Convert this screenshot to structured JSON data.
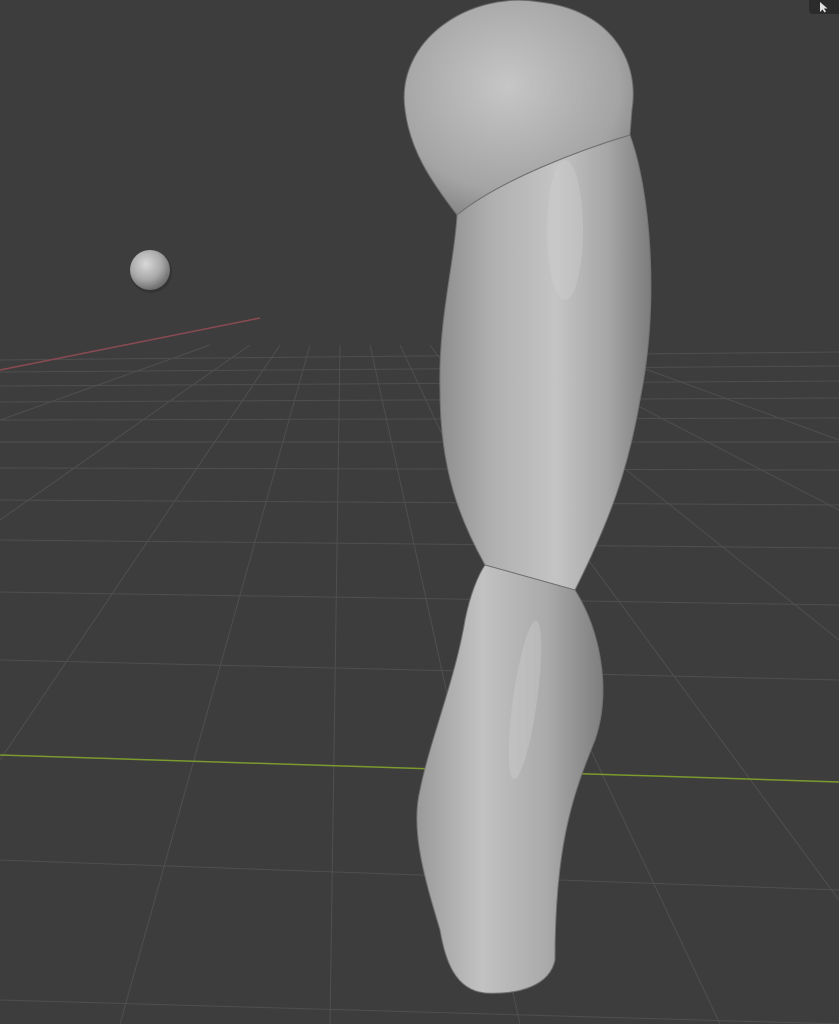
{
  "app": {
    "name": "3D viewport"
  },
  "viewport": {
    "background_color": "#3d3d3d",
    "grid_color": "#4e4e4e",
    "x_axis_color": "#8a4a52",
    "y_axis_color": "#7c9a2e",
    "object_color": "#b4b4b4"
  },
  "toolbar": {
    "select_tool_icon": "cursor-arrow-icon"
  }
}
